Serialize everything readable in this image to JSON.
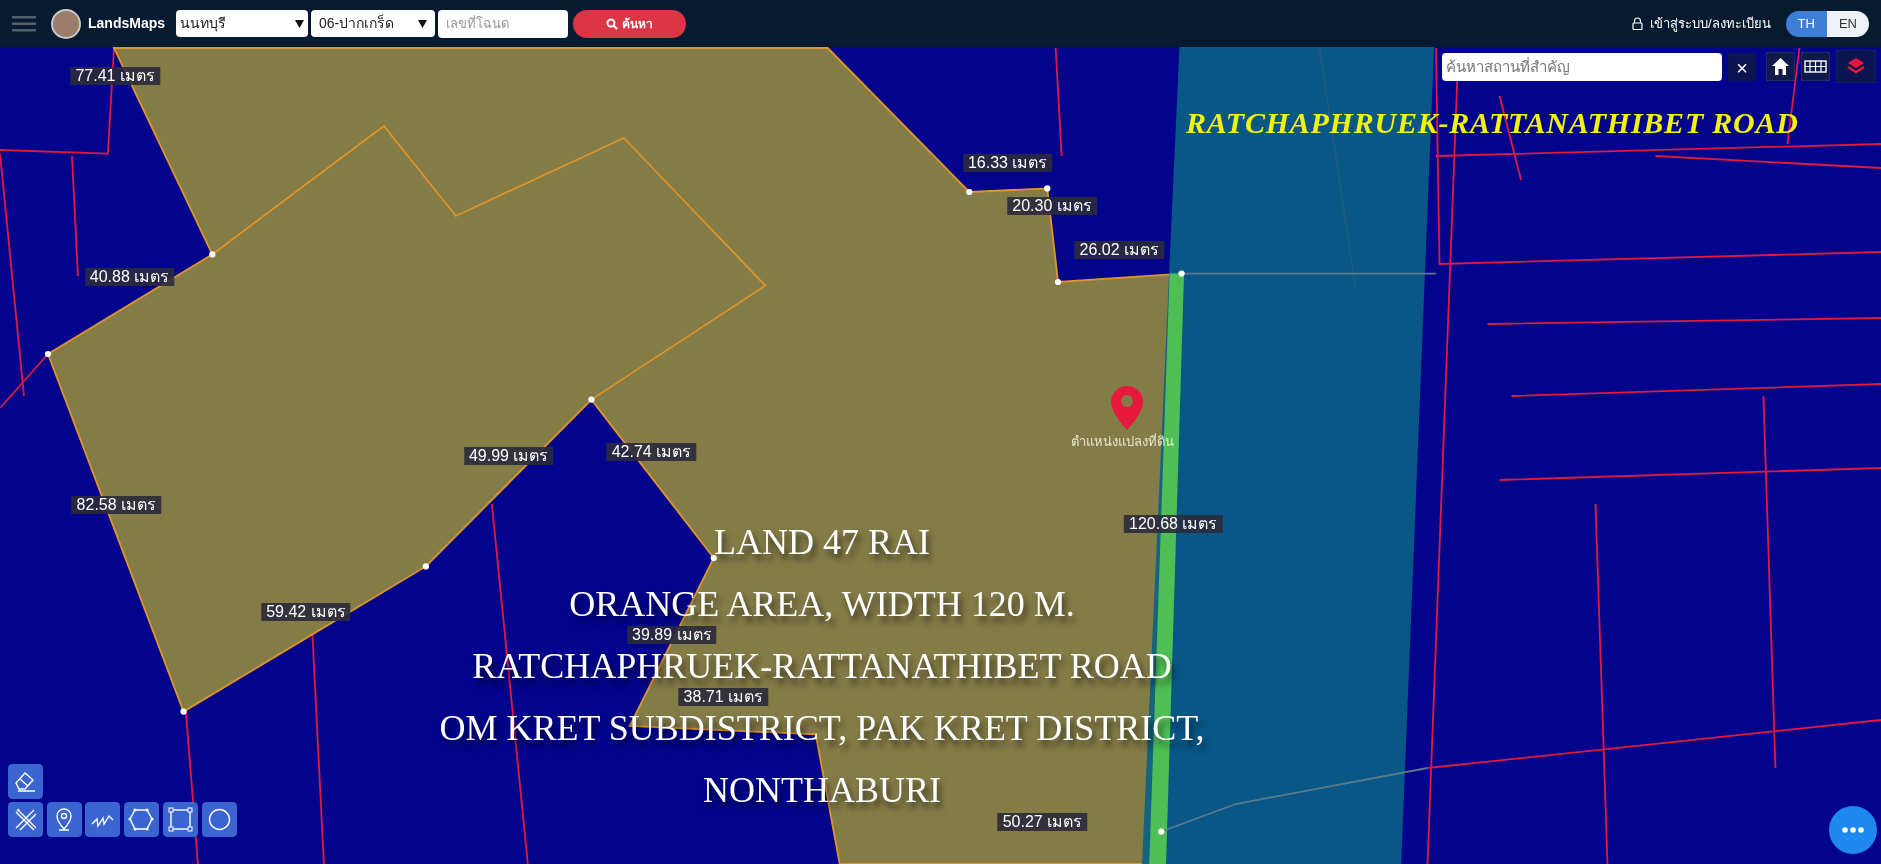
{
  "topbar": {
    "logo_text": "LandsMaps",
    "province": "นนทบุรี",
    "district": "06-ปากเกร็ด",
    "deed_placeholder": "เลขที่โฉนด",
    "search_button": "ค้นหา",
    "login": "เข้าสู่ระบบ/ลงทะเบียน",
    "languages": [
      {
        "label": "TH",
        "selected": true
      },
      {
        "label": "EN",
        "selected": false
      }
    ]
  },
  "map": {
    "place_search_placeholder": "ค้นหาสถานที่สำคัญ",
    "clear_button": "×",
    "marker_caption": "ตำแหน่งแปลงที่ดิน",
    "road_title": "RATCHAPHRUEK-RATTANATHIBET ROAD",
    "measurements": [
      "77.41 เมตร",
      "16.33 เมตร",
      "20.30 เมตร",
      "26.02 เมตร",
      "40.88 เมตร",
      "49.99 เมตร",
      "42.74 เมตร",
      "82.58 เมตร",
      "120.68 เมตร",
      "59.42 เมตร",
      "39.89 เมตร",
      "38.71 เมตร",
      "50.27 เมตร"
    ],
    "caption_lines": [
      "LAND 47 RAI",
      "ORANGE AREA, WIDTH 120 M.",
      "RATCHAPHRUEK-RATTANATHIBET ROAD",
      "OM KRET SUBDISTRICT, PAK KRET DISTRICT,",
      "NONTHABURI"
    ],
    "tools": [
      {
        "kind": "eraser"
      },
      {
        "kind": "pencil-ruler"
      },
      {
        "kind": "pin"
      },
      {
        "kind": "line"
      },
      {
        "kind": "polygon"
      },
      {
        "kind": "rectangle"
      },
      {
        "kind": "circle"
      }
    ]
  }
}
